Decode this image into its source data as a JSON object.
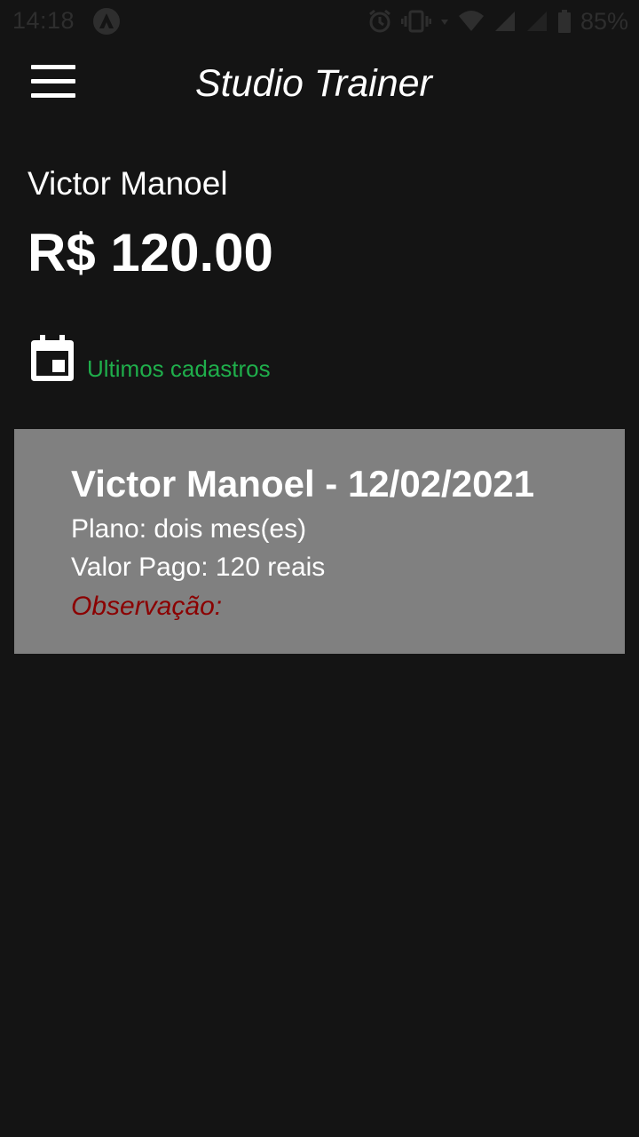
{
  "status_bar": {
    "time": "14:18",
    "battery": "85%"
  },
  "app_bar": {
    "title": "Studio Trainer",
    "menu_icon": "hamburger-menu-icon"
  },
  "summary": {
    "client_name": "Victor Manoel",
    "amount": "R$ 120.00"
  },
  "section": {
    "icon": "calendar-icon",
    "label": "Ultimos cadastros"
  },
  "records": [
    {
      "title": "Victor Manoel - 12/02/2021",
      "plan": "Plano: dois mes(es)",
      "value": "Valor Pago: 120 reais",
      "note": "Observação:"
    }
  ],
  "colors": {
    "background": "#141414",
    "accent_green": "#1fae4b",
    "card_background": "#808080",
    "note_red": "#8b0000"
  }
}
